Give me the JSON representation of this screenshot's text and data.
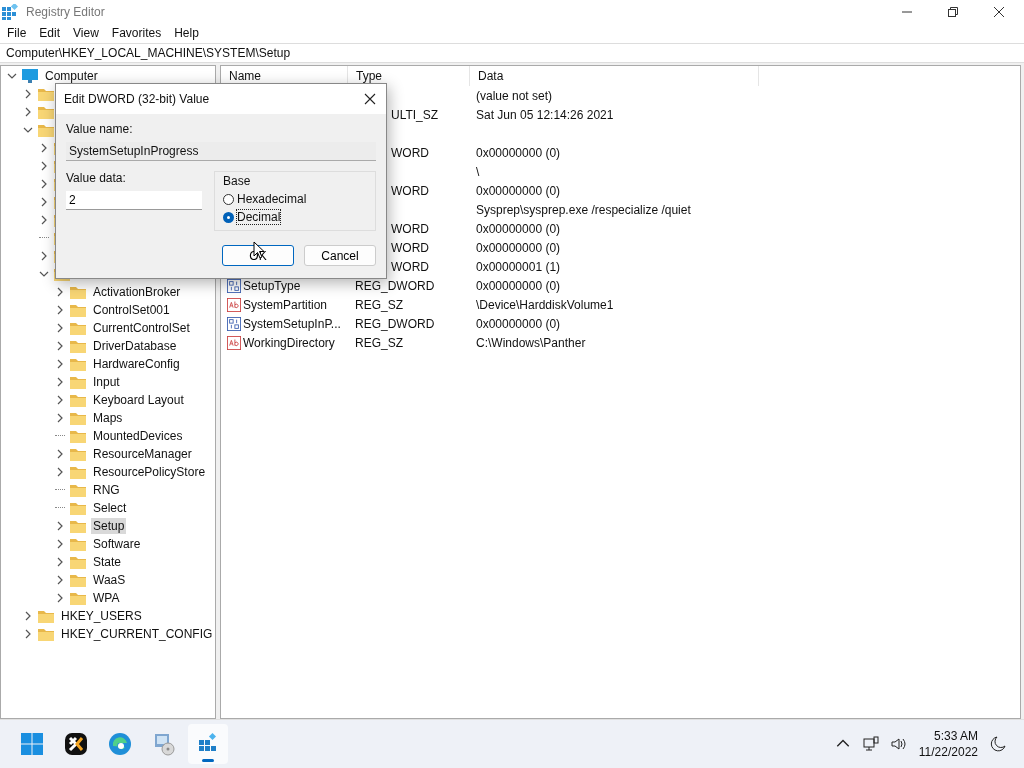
{
  "window": {
    "title": "Registry Editor"
  },
  "menu": [
    "File",
    "Edit",
    "View",
    "Favorites",
    "Help"
  ],
  "address": "Computer\\HKEY_LOCAL_MACHINE\\SYSTEM\\Setup",
  "tree": [
    {
      "label": "Computer",
      "kind": "computer",
      "expandable": true,
      "expanded": true,
      "selected": false,
      "children": [
        {
          "expandable": true,
          "expanded": false,
          "selected": false
        },
        {
          "expandable": true,
          "expanded": false,
          "selected": false
        },
        {
          "expandable": true,
          "expanded": true,
          "selected": false,
          "children": [
            {
              "expandable": true,
              "expanded": false,
              "selected": false
            },
            {
              "expandable": true,
              "expanded": false,
              "selected": false
            },
            {
              "expandable": true,
              "expanded": false,
              "selected": false
            },
            {
              "expandable": true,
              "expanded": false,
              "selected": false
            },
            {
              "expandable": true,
              "expanded": false,
              "selected": false
            },
            {
              "expandable": false,
              "expanded": false,
              "selected": false
            },
            {
              "expandable": true,
              "expanded": false,
              "selected": false
            },
            {
              "expandable": true,
              "expanded": true,
              "selected": false,
              "children": [
                {
                  "label": "ActivationBroker",
                  "expandable": true,
                  "expanded": false,
                  "selected": false
                },
                {
                  "label": "ControlSet001",
                  "expandable": true,
                  "expanded": false,
                  "selected": false
                },
                {
                  "label": "CurrentControlSet",
                  "expandable": true,
                  "expanded": false,
                  "selected": false
                },
                {
                  "label": "DriverDatabase",
                  "expandable": true,
                  "expanded": false,
                  "selected": false
                },
                {
                  "label": "HardwareConfig",
                  "expandable": true,
                  "expanded": false,
                  "selected": false
                },
                {
                  "label": "Input",
                  "expandable": true,
                  "expanded": false,
                  "selected": false
                },
                {
                  "label": "Keyboard Layout",
                  "expandable": true,
                  "expanded": false,
                  "selected": false
                },
                {
                  "label": "Maps",
                  "expandable": true,
                  "expanded": false,
                  "selected": false
                },
                {
                  "label": "MountedDevices",
                  "expandable": false,
                  "expanded": false,
                  "selected": false
                },
                {
                  "label": "ResourceManager",
                  "expandable": true,
                  "expanded": false,
                  "selected": false
                },
                {
                  "label": "ResourcePolicyStore",
                  "expandable": true,
                  "expanded": false,
                  "selected": false
                },
                {
                  "label": "RNG",
                  "expandable": false,
                  "expanded": false,
                  "selected": false
                },
                {
                  "label": "Select",
                  "expandable": false,
                  "expanded": false,
                  "selected": false
                },
                {
                  "label": "Setup",
                  "expandable": true,
                  "expanded": false,
                  "selected": true
                },
                {
                  "label": "Software",
                  "expandable": true,
                  "expanded": false,
                  "selected": false
                },
                {
                  "label": "State",
                  "expandable": true,
                  "expanded": false,
                  "selected": false
                },
                {
                  "label": "WaaS",
                  "expandable": true,
                  "expanded": false,
                  "selected": false
                },
                {
                  "label": "WPA",
                  "expandable": true,
                  "expanded": false,
                  "selected": false
                }
              ]
            }
          ]
        },
        {
          "label": "HKEY_USERS",
          "expandable": true,
          "expanded": false,
          "selected": false
        },
        {
          "label": "HKEY_CURRENT_CONFIG",
          "expandable": true,
          "expanded": false,
          "selected": false
        }
      ]
    }
  ],
  "table": {
    "columns": [
      "Name",
      "Type",
      "Data"
    ],
    "rows": [
      {
        "data": "(value not set)"
      },
      {
        "type": "ULTI_SZ",
        "data": "Sat Jun 05 12:14:26 2021"
      },
      {},
      {
        "type": "WORD",
        "data": "0x00000000 (0)"
      },
      {
        "data": "\\"
      },
      {
        "type": "WORD",
        "data": "0x00000000 (0)"
      },
      {
        "data": "Sysprep\\sysprep.exe /respecialize /quiet"
      },
      {
        "type": "WORD",
        "data": "0x00000000 (0)"
      },
      {
        "type": "WORD",
        "data": "0x00000000 (0)"
      },
      {
        "type": "WORD",
        "data": "0x00000001 (1)"
      },
      {
        "kind": "binary",
        "name": "SetupType",
        "type": "REG_DWORD",
        "data": "0x00000000 (0)"
      },
      {
        "kind": "string",
        "name": "SystemPartition",
        "type": "REG_SZ",
        "data": "\\Device\\HarddiskVolume1"
      },
      {
        "kind": "binary",
        "name": "SystemSetupInP...",
        "type": "REG_DWORD",
        "data": "0x00000000 (0)"
      },
      {
        "kind": "string",
        "name": "WorkingDirectory",
        "type": "REG_SZ",
        "data": "C:\\Windows\\Panther"
      }
    ]
  },
  "dialog": {
    "title": "Edit DWORD (32-bit) Value",
    "value_name_label": "Value name:",
    "value_name": "SystemSetupInProgress",
    "value_data_label": "Value data:",
    "value_data": "2",
    "base_label": "Base",
    "radios": [
      {
        "label": "Hexadecimal",
        "selected": false
      },
      {
        "label": "Decimal",
        "selected": true
      }
    ],
    "buttons": [
      "OK",
      "Cancel"
    ]
  },
  "taskbar": {
    "apps": [
      {
        "kind": "start",
        "active": false
      },
      {
        "kind": "xtool",
        "active": false
      },
      {
        "kind": "edge",
        "active": false
      },
      {
        "kind": "pc",
        "active": false
      },
      {
        "kind": "regedit",
        "active": true
      }
    ],
    "time": "5:33 AM",
    "date": "11/22/2022"
  }
}
